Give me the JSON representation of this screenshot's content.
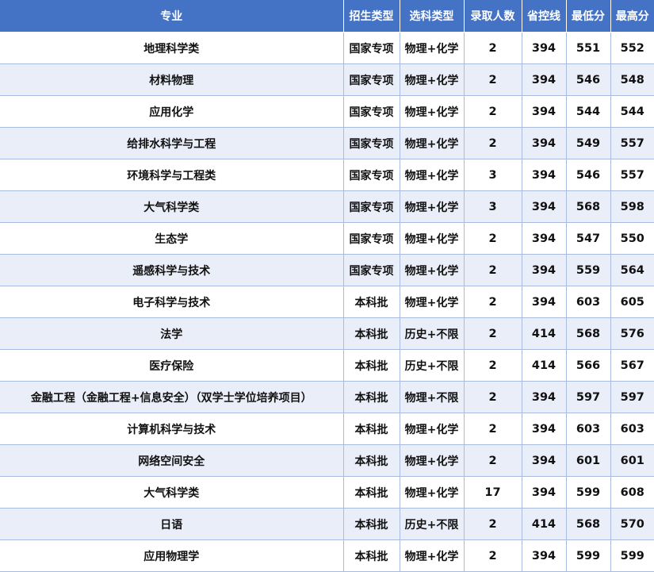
{
  "table": {
    "headers": [
      "专业",
      "招生类型",
      "选科类型",
      "录取人数",
      "省控线",
      "最低分",
      "最高分"
    ],
    "rows": [
      [
        "地理科学类",
        "国家专项",
        "物理+化学",
        "2",
        "394",
        "551",
        "552"
      ],
      [
        "材料物理",
        "国家专项",
        "物理+化学",
        "2",
        "394",
        "546",
        "548"
      ],
      [
        "应用化学",
        "国家专项",
        "物理+化学",
        "2",
        "394",
        "544",
        "544"
      ],
      [
        "给排水科学与工程",
        "国家专项",
        "物理+化学",
        "2",
        "394",
        "549",
        "557"
      ],
      [
        "环境科学与工程类",
        "国家专项",
        "物理+化学",
        "3",
        "394",
        "546",
        "557"
      ],
      [
        "大气科学类",
        "国家专项",
        "物理+化学",
        "3",
        "394",
        "568",
        "598"
      ],
      [
        "生态学",
        "国家专项",
        "物理+化学",
        "2",
        "394",
        "547",
        "550"
      ],
      [
        "遥感科学与技术",
        "国家专项",
        "物理+化学",
        "2",
        "394",
        "559",
        "564"
      ],
      [
        "电子科学与技术",
        "本科批",
        "物理+化学",
        "2",
        "394",
        "603",
        "605"
      ],
      [
        "法学",
        "本科批",
        "历史+不限",
        "2",
        "414",
        "568",
        "576"
      ],
      [
        "医疗保险",
        "本科批",
        "历史+不限",
        "2",
        "414",
        "566",
        "567"
      ],
      [
        "金融工程（金融工程+信息安全）（双学士学位培养项目）",
        "本科批",
        "物理+不限",
        "2",
        "394",
        "597",
        "597"
      ],
      [
        "计算机科学与技术",
        "本科批",
        "物理+化学",
        "2",
        "394",
        "603",
        "603"
      ],
      [
        "网络空间安全",
        "本科批",
        "物理+化学",
        "2",
        "394",
        "601",
        "601"
      ],
      [
        "大气科学类",
        "本科批",
        "物理+化学",
        "17",
        "394",
        "599",
        "608"
      ],
      [
        "日语",
        "本科批",
        "历史+不限",
        "2",
        "414",
        "568",
        "570"
      ],
      [
        "应用物理学",
        "本科批",
        "物理+化学",
        "2",
        "394",
        "599",
        "599"
      ]
    ]
  }
}
